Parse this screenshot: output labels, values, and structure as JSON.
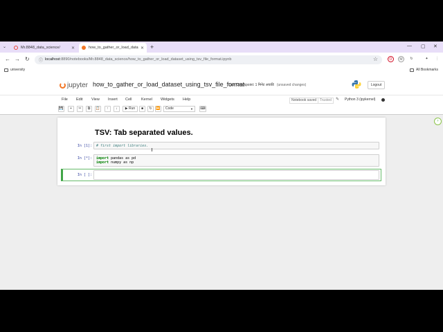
{
  "browser": {
    "tab_list_icon": "chevron-down-icon",
    "tabs": [
      {
        "title": "Mr.8848_data_science/",
        "favicon_color": "#e94235"
      },
      {
        "title": "how_to_gather_or_load_datase",
        "favicon_color": "#f37726"
      }
    ],
    "new_tab_glyph": "+",
    "minimize": "—",
    "maximize": "▢",
    "close": "✕",
    "url_host": "localhost",
    "url_path": ":8890/notebooks/Mr.8848_data_science/how_to_gather_or_load_dataset_using_tsv_file_format.ipynb",
    "extensions": [
      {
        "label": "O",
        "color": "#d0021b"
      },
      {
        "label": "M",
        "color": "#666666"
      },
      {
        "label": "↻",
        "color": "#444444"
      },
      {
        "label": "✦",
        "color": "#444444"
      }
    ],
    "bookmarks": [
      {
        "label": "university"
      }
    ],
    "all_bookmarks": "All Bookmarks"
  },
  "jupyter": {
    "logo_text": "jupyter",
    "notebook_name": "how_to_gather_or_load_dataset_using_tsv_file_format",
    "last_checkpoint": "Last Checkpoint: 1 मिनेट अघाडि",
    "unsaved": "(unsaved changes)",
    "logout": "Logout",
    "menu": [
      "File",
      "Edit",
      "View",
      "Insert",
      "Cell",
      "Kernel",
      "Widgets",
      "Help"
    ],
    "notebook_saved": "Notebook saved",
    "trusted": "Trusted",
    "kernel": "Python 3 (ipykernel)",
    "toolbar": {
      "save": "💾",
      "add": "+",
      "cut": "✂",
      "copy": "⧉",
      "paste": "📋",
      "up": "↑",
      "down": "↓",
      "run": "▶ Run",
      "stop": "■",
      "restart": "↻",
      "fastforward": "⏩",
      "cell_type": "Code",
      "keyboard": "⌨"
    }
  },
  "notebook": {
    "heading": "TSV: Tab separated values.",
    "cells": [
      {
        "prompt": "In [1]:",
        "code": "# first import libraries."
      },
      {
        "prompt": "In [*]:",
        "line1_kw": "import",
        "line1_rest": " pandas as pd",
        "line2_kw": "import",
        "line2_rest": " numpy as np"
      },
      {
        "prompt": "In [ ]:",
        "code": ""
      }
    ]
  }
}
